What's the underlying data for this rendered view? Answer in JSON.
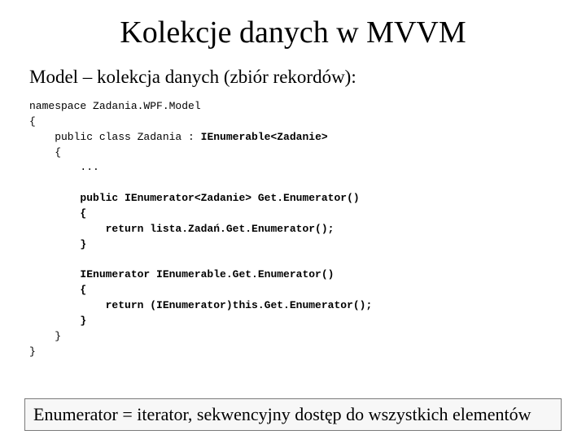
{
  "title": "Kolekcje danych w MVVM",
  "subtitle": "Model – kolekcja danych (zbiór rekordów):",
  "code": {
    "l1": "namespace Zadania.WPF.Model",
    "l2": "{",
    "l3": "    public class Zadania : ",
    "l3b": "IEnumerable<Zadanie>",
    "l4": "    {",
    "l5": "        ...",
    "l6": "",
    "l7": "        public IEnumerator<Zadanie> Get.Enumerator()",
    "l8": "        {",
    "l9": "            return lista.Zadań.Get.Enumerator();",
    "l10": "        }",
    "l11": "",
    "l12": "        IEnumerator IEnumerable.Get.Enumerator()",
    "l13": "        {",
    "l14": "            return (IEnumerator)this.Get.Enumerator();",
    "l15": "        }",
    "l16": "    }",
    "l17": "}"
  },
  "footer": "Enumerator = iterator, sekwencyjny dostęp do wszystkich elementów"
}
